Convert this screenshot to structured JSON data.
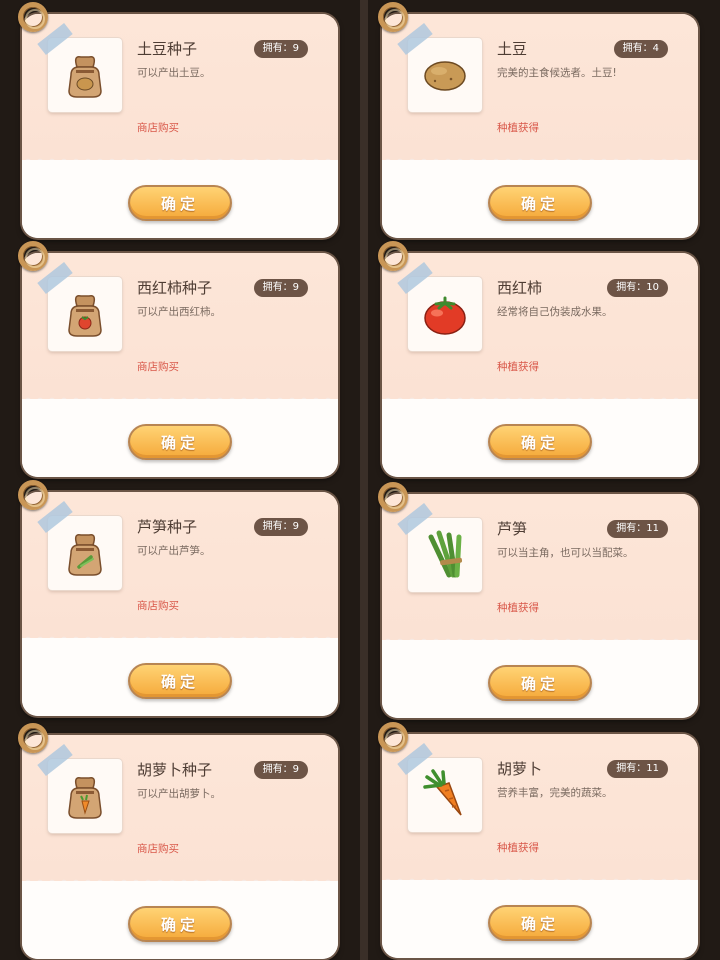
{
  "cards": [
    {
      "title": "土豆种子",
      "badge": "拥有：9",
      "desc": "可以产出土豆。",
      "source": "商店购买",
      "confirm": "确定",
      "icon": "seed-bag-potato-icon"
    },
    {
      "title": "土豆",
      "badge": "拥有：4",
      "desc": "完美的主食候选者。土豆!",
      "source": "种植获得",
      "confirm": "确定",
      "icon": "potato-icon"
    },
    {
      "title": "西红柿种子",
      "badge": "拥有：9",
      "desc": "可以产出西红柿。",
      "source": "商店购买",
      "confirm": "确定",
      "icon": "seed-bag-tomato-icon"
    },
    {
      "title": "西红柿",
      "badge": "拥有：10",
      "desc": "经常将自己伪装成水果。",
      "source": "种植获得",
      "confirm": "确定",
      "icon": "tomato-icon"
    },
    {
      "title": "芦笋种子",
      "badge": "拥有：9",
      "desc": "可以产出芦笋。",
      "source": "商店购买",
      "confirm": "确定",
      "icon": "seed-bag-asparagus-icon"
    },
    {
      "title": "芦笋",
      "badge": "拥有：11",
      "desc": "可以当主角，也可以当配菜。",
      "source": "种植获得",
      "confirm": "确定",
      "icon": "asparagus-icon"
    },
    {
      "title": "胡萝卜种子",
      "badge": "拥有：9",
      "desc": "可以产出胡萝卜。",
      "source": "商店购买",
      "confirm": "确定",
      "icon": "seed-bag-carrot-icon"
    },
    {
      "title": "胡萝卜",
      "badge": "拥有：11",
      "desc": "营养丰富，完美的蔬菜。",
      "source": "种植获得",
      "confirm": "确定",
      "icon": "carrot-icon"
    }
  ],
  "colors": {
    "card_top": "#fde6d8",
    "badge": "#6d5446",
    "source": "#d9584a",
    "button": "#f5a93a"
  }
}
